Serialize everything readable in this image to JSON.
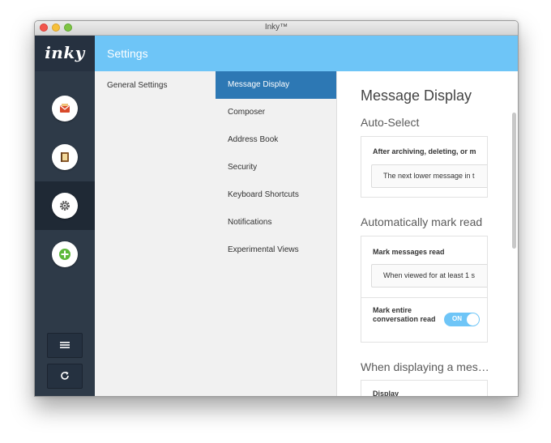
{
  "window": {
    "title": "Inky™"
  },
  "rail": {
    "logo": "inky",
    "buttons": [
      {
        "icon": "mail-icon"
      },
      {
        "icon": "address-book-icon"
      },
      {
        "icon": "gear-icon"
      },
      {
        "icon": "plus-icon"
      }
    ],
    "bottom": [
      {
        "icon": "hamburger-icon"
      },
      {
        "icon": "refresh-icon"
      }
    ]
  },
  "header": {
    "title": "Settings"
  },
  "col1": {
    "items": [
      "General Settings"
    ]
  },
  "nav": {
    "items": [
      {
        "label": "Message Display"
      },
      {
        "label": "Composer"
      },
      {
        "label": "Address Book"
      },
      {
        "label": "Security"
      },
      {
        "label": "Keyboard Shortcuts"
      },
      {
        "label": "Notifications"
      },
      {
        "label": "Experimental Views"
      }
    ]
  },
  "content": {
    "title": "Message Display",
    "auto_select": {
      "heading": "Auto-Select",
      "label": "After archiving, deleting, or m",
      "value": "The next lower message in t"
    },
    "mark_read": {
      "heading": "Automatically mark read",
      "label": "Mark messages read",
      "value": "When viewed for at least 1 s",
      "toggle_label": "Mark entire conversation read",
      "toggle_state": "ON"
    },
    "displaying": {
      "heading": "When displaying a mes…",
      "label": "Display"
    }
  },
  "colors": {
    "accent": "#6ec5f7",
    "nav_active": "#2d78b4",
    "rail": "#2e3a48"
  }
}
